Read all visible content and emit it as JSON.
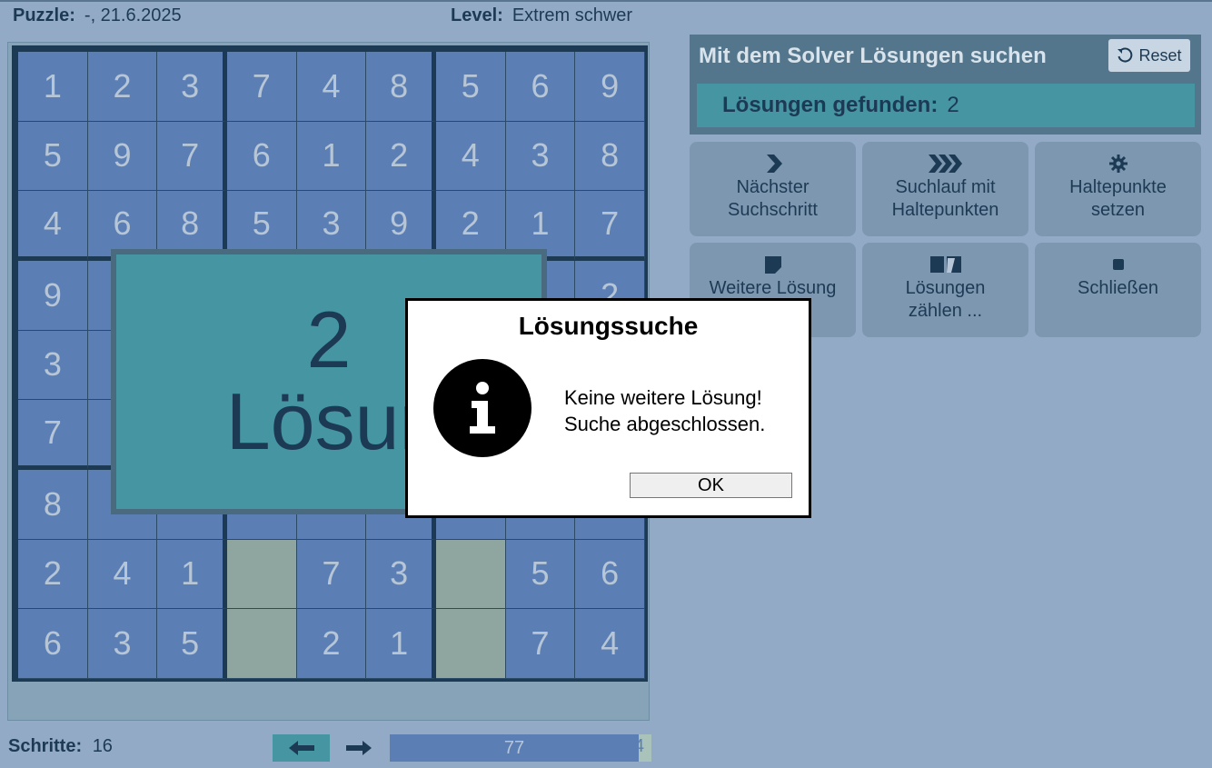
{
  "header": {
    "puzzle_label": "Puzzle:",
    "puzzle_value": "-,  21.6.2025",
    "level_label": "Level:",
    "level_value": "Extrem schwer"
  },
  "board": {
    "rows": [
      [
        "1",
        "2",
        "3",
        "7",
        "4",
        "8",
        "5",
        "6",
        "9"
      ],
      [
        "5",
        "9",
        "7",
        "6",
        "1",
        "2",
        "4",
        "3",
        "8"
      ],
      [
        "4",
        "6",
        "8",
        "5",
        "3",
        "9",
        "2",
        "1",
        "7"
      ],
      [
        "9",
        "",
        "",
        "",
        "",
        "",
        "",
        "",
        "2"
      ],
      [
        "3",
        "",
        "",
        "",
        "",
        "",
        "",
        "",
        ""
      ],
      [
        "7",
        "",
        "",
        "",
        "",
        "",
        "",
        "",
        ""
      ],
      [
        "8",
        "",
        "",
        "",
        "",
        "",
        "",
        "",
        ""
      ],
      [
        "2",
        "4",
        "1",
        "",
        "7",
        "3",
        "",
        "5",
        "6"
      ],
      [
        "6",
        "3",
        "5",
        "",
        "2",
        "1",
        "",
        "7",
        "4"
      ]
    ],
    "empty_cells": [
      [
        7,
        3
      ],
      [
        7,
        6
      ],
      [
        8,
        3
      ],
      [
        8,
        6
      ]
    ]
  },
  "overlay": {
    "count": "2",
    "label": "Lösungen"
  },
  "footer": {
    "steps_label": "Schritte:",
    "steps_value": "16",
    "progress_value": "77",
    "progress_tail": "4"
  },
  "solver": {
    "title": "Mit dem Solver Lösungen suchen",
    "reset_label": "Reset",
    "found_label": "Lösungen gefunden:",
    "found_value": "2",
    "tools": [
      {
        "line1": "Nächster",
        "line2": "Suchschritt",
        "icon": "chevron-right-icon"
      },
      {
        "line1": "Suchlauf mit",
        "line2": "Haltepunkten",
        "icon": "triple-chevron-icon"
      },
      {
        "line1": "Haltepunkte",
        "line2": "setzen",
        "icon": "gear-icon"
      },
      {
        "line1": "Weitere Lösung",
        "line2": "",
        "icon": "page-icon"
      },
      {
        "line1": "Lösungen",
        "line2": "zählen ...",
        "icon": "book-icon"
      },
      {
        "line1": "Schließen",
        "line2": "",
        "icon": "stop-icon"
      }
    ]
  },
  "dialog": {
    "title": "Lösungssuche",
    "line1": "Keine weitere Lösung!",
    "line2": "Suche abgeschlossen.",
    "ok_label": "OK",
    "icon": "info-icon"
  },
  "colors": {
    "background": "#93aac6",
    "cell": "#5b7fb5",
    "empty_cell": "#8fa6a0",
    "accent_teal": "#4695a3",
    "dark": "#1d3a55"
  }
}
